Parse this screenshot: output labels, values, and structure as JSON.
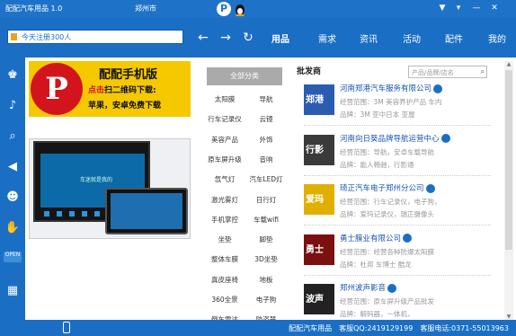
{
  "titlebar": {
    "app_name": "配配汽车用品 1.0",
    "city": "郑州市",
    "controls": [
      "▼",
      "▾",
      "—",
      "✕"
    ]
  },
  "navbar": {
    "search_text": "今天注册300人",
    "back": "←",
    "forward": "→",
    "refresh": "↻",
    "tabs": [
      {
        "label": "用品",
        "active": true
      },
      {
        "label": "需求",
        "active": false
      },
      {
        "label": "资讯",
        "active": false
      },
      {
        "label": "活动",
        "active": false
      },
      {
        "label": "配件",
        "active": false
      },
      {
        "label": "我的",
        "active": false
      }
    ]
  },
  "rail": {
    "open_label": "OPEN"
  },
  "banner": {
    "letter": "P",
    "title": "配配手机版",
    "line2_red": "点击",
    "line2": "扫二维码下载:",
    "line3": "苹果，安卓免费下载"
  },
  "photo": {
    "screen_text": "车迷就是我的"
  },
  "categories": {
    "header": "全部分类",
    "items": [
      [
        "太阳膜",
        "导航"
      ],
      [
        "行车记录仪",
        "云镜"
      ],
      [
        "美容产品",
        "外饰"
      ],
      [
        "原车屏升级",
        "音响"
      ],
      [
        "氙气灯",
        "汽车LED灯"
      ],
      [
        "激光雾灯",
        "日行灯"
      ],
      [
        "手机掌控",
        "车载wifi"
      ],
      [
        "坐垫",
        "脚垫"
      ],
      [
        "整体车膜",
        "3D坐垫"
      ],
      [
        "真皮座椅",
        "地板"
      ],
      [
        "360全景",
        "电子狗"
      ],
      [
        "倒车雷达",
        "防盗器"
      ]
    ]
  },
  "suppliers": {
    "heading": "批发商",
    "search_placeholder": "产品/品牌/店名",
    "search_icon": "magnifier-icon",
    "items": [
      {
        "logo": "郑港",
        "logo_color": "#2a5db0",
        "name": "河南郑港汽车服务有限公司",
        "scope": "经营范围：3M 美容养护产品 车内",
        "brand": "品牌：3M 亚中日本 亚屋"
      },
      {
        "logo": "行影",
        "logo_color": "#3a3a3a",
        "name": "河南向日葵品牌导航运营中心",
        "scope": "经营范围：导航，安卓车载导航",
        "brand": "品牌：能人畅驰，行影通"
      },
      {
        "logo": "爱玛",
        "logo_color": "#e0b000",
        "name": "琦正汽车电子郑州分公司",
        "scope": "经营范围：行车记录仪，电子狗，",
        "brand": "品牌：爱玛记录仪，瑞正摄像头"
      },
      {
        "logo": "勇士",
        "logo_color": "#7a1010",
        "name": "勇士膜业有限公司",
        "scope": "经营范围：经营各种防爆太阳膜",
        "brand": "品牌：杜邦 车博士 酷龙"
      },
      {
        "logo": "波声",
        "logo_color": "#222222",
        "name": "郑州波声影音",
        "scope": "经营范围：原车屏升级产品批发",
        "brand": "品牌：解码器，一体机，"
      }
    ]
  },
  "bottom": {
    "brand": "配配汽车用品",
    "qq": "客服QQ:2419129199",
    "phone": "客服电话:0371-55013963"
  }
}
